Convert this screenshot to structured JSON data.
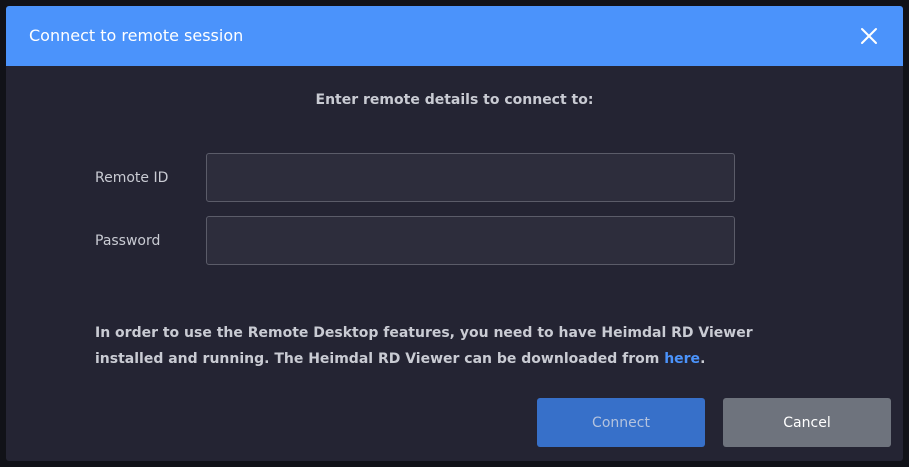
{
  "dialog": {
    "title": "Connect to remote session",
    "close_icon": "close-icon",
    "subtitle": "Enter remote details to connect to:"
  },
  "form": {
    "remote_id": {
      "label": "Remote ID",
      "value": "",
      "placeholder": ""
    },
    "password": {
      "label": "Password",
      "value": "",
      "placeholder": ""
    }
  },
  "info": {
    "text": "In order to use the Remote Desktop features, you need to have Heimdal RD Viewer installed and running. The Heimdal RD Viewer can be downloaded from ",
    "link_text": "here",
    "suffix": "."
  },
  "buttons": {
    "connect": "Connect",
    "cancel": "Cancel"
  },
  "colors": {
    "header": "#4b93fb",
    "dialog_bg": "#242433",
    "link": "#4b93fb",
    "connect_button": "#3770c9",
    "cancel_button": "#6e737d"
  }
}
